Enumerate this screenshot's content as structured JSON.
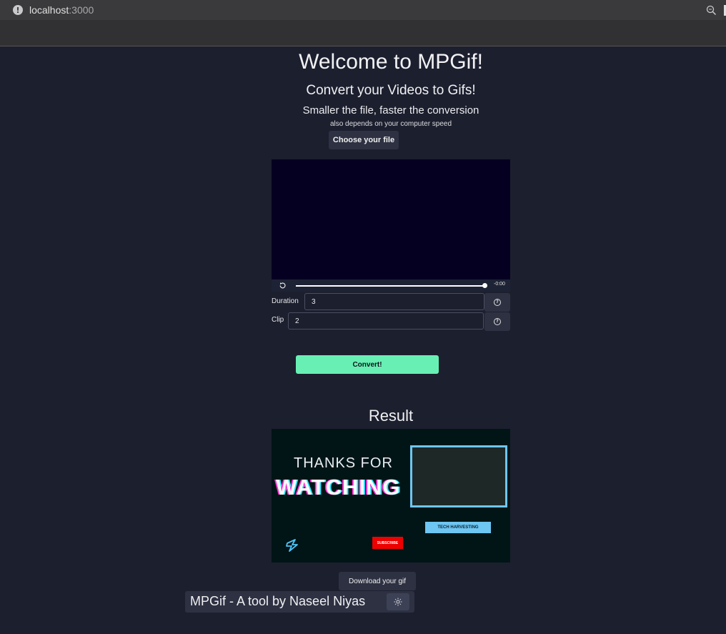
{
  "browser": {
    "host": "localhost",
    "port": ":3000"
  },
  "header": {
    "title": "Welcome to MPGif!",
    "subtitle": "Convert your Videos to Gifs!",
    "tagline": "Smaller the file, faster the conversion",
    "note": "also depends on your computer speed"
  },
  "upload": {
    "button_label": "Choose your file"
  },
  "player": {
    "time": "-0:00",
    "progress": 1.0
  },
  "form": {
    "duration": {
      "label": "Duration",
      "value": "3"
    },
    "clip": {
      "label": "Clip",
      "value": "2"
    },
    "convert_label": "Convert!"
  },
  "result": {
    "title": "Result",
    "gif": {
      "line1": "THANKS FOR",
      "line2": "WATCHING",
      "channel": "TECH HARVESTING",
      "subscribe": "SUBSCRIBE"
    },
    "download_label": "Download your gif"
  },
  "footer": {
    "text": "MPGif - A tool by Naseel Niyas",
    "theme_icon": "sun-icon"
  },
  "colors": {
    "background": "#1c1f2e",
    "accent": "#68f0b4",
    "button": "#2d3142"
  }
}
